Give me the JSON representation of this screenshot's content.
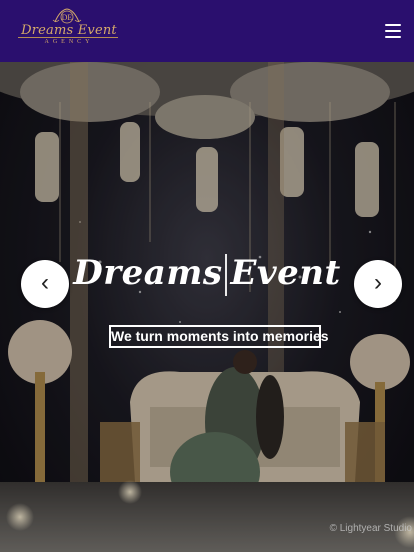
{
  "navbar": {
    "brand_name": "Dreams Event",
    "brand_sub": "AGENCY",
    "brand_monogram": "DE",
    "menu_icon": "hamburger-menu-icon",
    "background": "#2a0f6e",
    "brand_color": "#d6aa6a"
  },
  "hero": {
    "title_left": "Dreams",
    "title_right": "Event",
    "tagline": "We turn moments into memories",
    "prev_label": "‹",
    "next_label": "›",
    "photo_credit": "© Lightyear Studio"
  }
}
